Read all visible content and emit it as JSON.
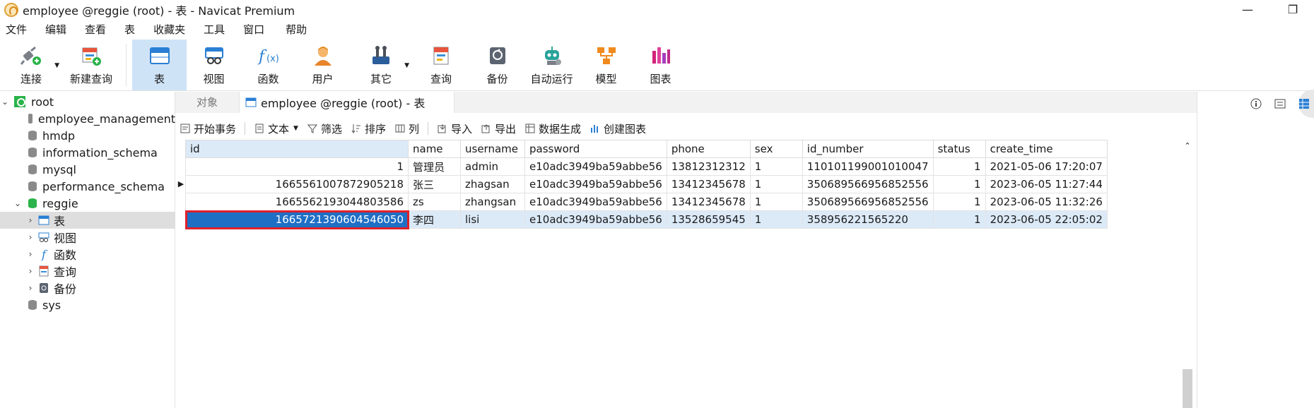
{
  "window": {
    "title": "employee @reggie (root) - 表 - Navicat Premium",
    "minimize_glyph": "—",
    "restore_glyph": "❐"
  },
  "menu": [
    "文件",
    "编辑",
    "查看",
    "表",
    "收藏夹",
    "工具",
    "窗口",
    "帮助"
  ],
  "toolbar": {
    "connect": "连接",
    "new_query": "新建查询",
    "table": "表",
    "view": "视图",
    "function": "函数",
    "user": "用户",
    "other": "其它",
    "query": "查询",
    "backup": "备份",
    "automation": "自动运行",
    "model": "模型",
    "chart": "图表"
  },
  "sidebar": {
    "root": "root",
    "databases": [
      "employee_management",
      "hmdp",
      "information_schema",
      "mysql",
      "performance_schema"
    ],
    "open_db": "reggie",
    "children": [
      "表",
      "视图",
      "函数",
      "查询",
      "备份"
    ],
    "last_db": "sys"
  },
  "tabs": {
    "objects": "对象",
    "active": "employee @reggie (root) - 表"
  },
  "subtoolbar": {
    "begin_tx": "开始事务",
    "text": "文本",
    "filter": "筛选",
    "sort": "排序",
    "columns": "列",
    "import": "导入",
    "export": "导出",
    "generate": "数据生成",
    "create_chart": "创建图表"
  },
  "table": {
    "columns": [
      "id",
      "name",
      "username",
      "password",
      "phone",
      "sex",
      "id_number",
      "status",
      "create_time"
    ],
    "rows": [
      [
        "1",
        "管理员",
        "admin",
        "e10adc3949ba59abbe56",
        "13812312312",
        "1",
        "110101199001010047",
        "1",
        "2021-05-06 17:20:07"
      ],
      [
        "1665561007872905218",
        "张三",
        "zhagsan",
        "e10adc3949ba59abbe56",
        "13412345678",
        "1",
        "350689566956852556",
        "1",
        "2023-06-05 11:27:44"
      ],
      [
        "1665562193044803586",
        "zs",
        "zhangsan",
        "e10adc3949ba59abbe56",
        "13412345678",
        "1",
        "350689566956852556",
        "1",
        "2023-06-05 11:32:26"
      ],
      [
        "1665721390604546050",
        "李四",
        "lisi",
        "e10adc3949ba59abbe56",
        "13528659545",
        "1",
        "358956221565220",
        "1",
        "2023-06-05 22:05:02"
      ]
    ],
    "selected_row": 3
  }
}
